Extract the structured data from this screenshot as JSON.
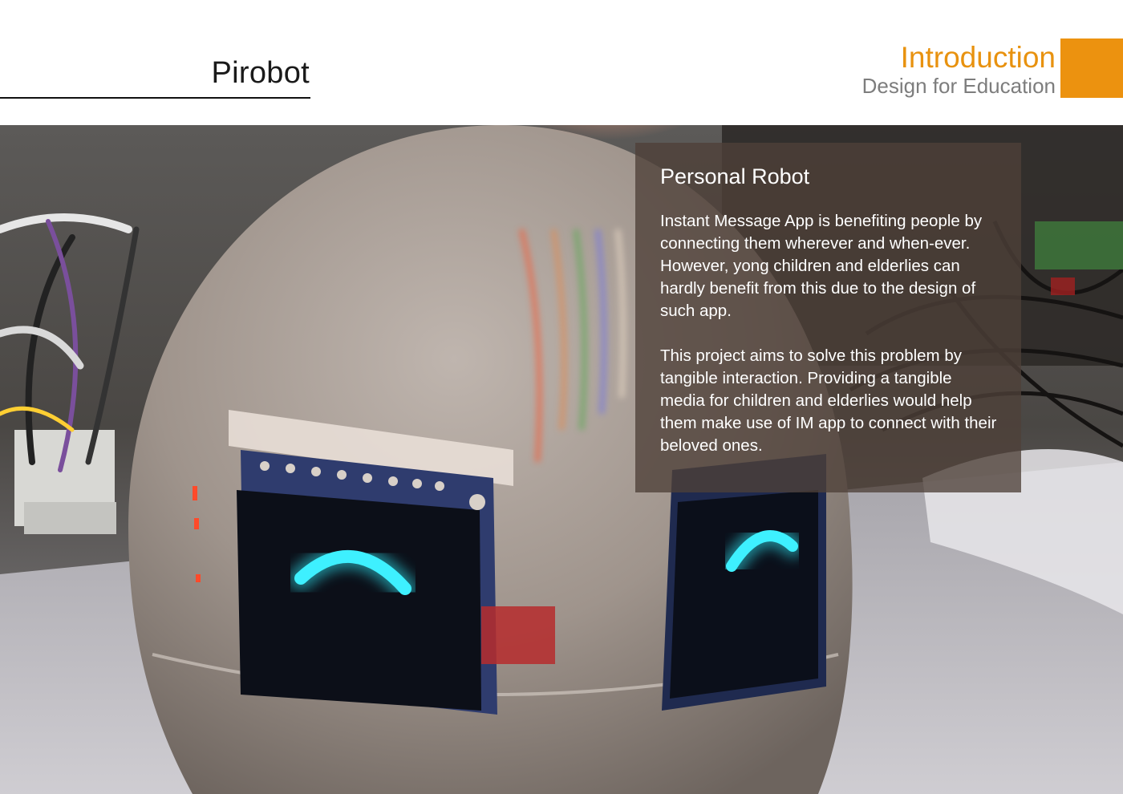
{
  "header": {
    "doc_title": "Pirobot",
    "section_title": "Introduction",
    "section_subtitle": "Design for Education"
  },
  "panel": {
    "heading": "Personal Robot",
    "paragraphs": [
      "Instant Message App is benefiting people by connecting them wherever and when-ever. However, yong children and elderlies can hardly benefit from this due to the design of such app.",
      "This project aims to solve this problem by tangible interaction. Providing a tangible media for children and elderlies would help them make use of IM app to connect with their beloved ones."
    ]
  },
  "colors": {
    "accent": "#ec920f",
    "section_title": "#e8920f",
    "eye_glow": "#2fe4f2",
    "panel_bg": "#4e4038"
  },
  "photo": {
    "subject": "egg-shaped-robot-with-oled-eyes"
  }
}
